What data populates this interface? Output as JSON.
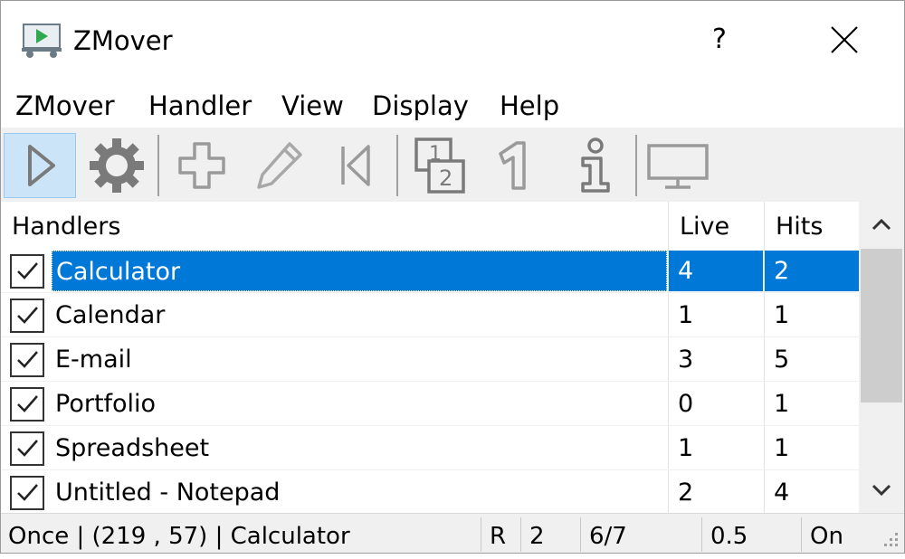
{
  "window": {
    "title": "ZMover",
    "help_button": "?"
  },
  "menu": {
    "items": [
      "ZMover",
      "Handler",
      "View",
      "Display",
      "Help"
    ]
  },
  "toolbar": {
    "buttons": [
      {
        "icon": "play-icon",
        "active": true
      },
      {
        "icon": "gear-icon",
        "active": false
      },
      {
        "icon": "plus-icon",
        "active": false
      },
      {
        "icon": "pencil-icon",
        "active": false
      },
      {
        "icon": "skip-back-icon",
        "active": false
      },
      {
        "icon": "order-1-2-icon",
        "active": false
      },
      {
        "icon": "number-one-icon",
        "active": false
      },
      {
        "icon": "info-icon",
        "active": false
      },
      {
        "icon": "monitor-icon",
        "active": false
      }
    ]
  },
  "list": {
    "columns": [
      "Handlers",
      "Live",
      "Hits"
    ],
    "rows": [
      {
        "name": "Calculator",
        "live": "4",
        "hits": "2",
        "checked": true,
        "selected": true
      },
      {
        "name": "Calendar",
        "live": "1",
        "hits": "1",
        "checked": true,
        "selected": false
      },
      {
        "name": "E-mail",
        "live": "3",
        "hits": "5",
        "checked": true,
        "selected": false
      },
      {
        "name": "Portfolio",
        "live": "0",
        "hits": "1",
        "checked": true,
        "selected": false
      },
      {
        "name": "Spreadsheet",
        "live": "1",
        "hits": "1",
        "checked": true,
        "selected": false
      },
      {
        "name": "Untitled - Notepad",
        "live": "2",
        "hits": "4",
        "checked": true,
        "selected": false
      }
    ]
  },
  "status": {
    "main": "Once | (219 , 57) | Calculator",
    "pane1": "R",
    "pane2": "2",
    "pane3": "6/7",
    "pane4": "0.5",
    "pane5": "On"
  },
  "colors": {
    "selection": "#0078d7",
    "toolbar_active": "#cce4f7",
    "icon_gray": "#8a8a8a"
  }
}
